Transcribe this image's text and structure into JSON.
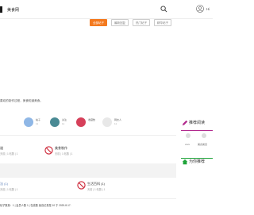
{
  "header": {
    "site_name": "美食网",
    "user_text": "Hi"
  },
  "tabs": [
    {
      "label": "全部帖子",
      "active": true
    },
    {
      "label": "最新回复",
      "active": false
    },
    {
      "label": "热门帖子",
      "active": false
    },
    {
      "label": "精华帖子",
      "active": false
    }
  ],
  "intro": {
    "text": "喜欢的制作过程，美食知道美食。"
  },
  "stats": [
    {
      "label": "帖子",
      "value": "11",
      "color": "#8fb7e6"
    },
    {
      "label": "关注",
      "value": "11",
      "color": "#4a8a94"
    },
    {
      "label": "收藏数",
      "value": "",
      "color": "#d6405a"
    },
    {
      "label": "网友人",
      "value": "11",
      "color": "#e8e8e8"
    }
  ],
  "cards": {
    "row1_left": {
      "title": "道",
      "sub": "天前 | 1 帖数 | 1"
    },
    "row1_right": {
      "title": "美食制作",
      "sub": "天前 | 1 帖数 | 1"
    },
    "row2_left": {
      "title": "法 (1)",
      "sub": "天前 | 1 帖数 | 1"
    },
    "row2_right": {
      "title": "生活百科 (1)",
      "sub": "天前 | 1 帖数 | 1"
    }
  },
  "footer": {
    "text": "帖子数量：1 | 会员人数 1 | 在线数 最高记录是 10 于 2020-8-17."
  },
  "sidebar": {
    "recommend_title": "推荐阅读",
    "recommend_items": [
      {
        "label": "xxxx"
      },
      {
        "label": "美食类目"
      }
    ],
    "for_you_title": "为你推荐"
  }
}
